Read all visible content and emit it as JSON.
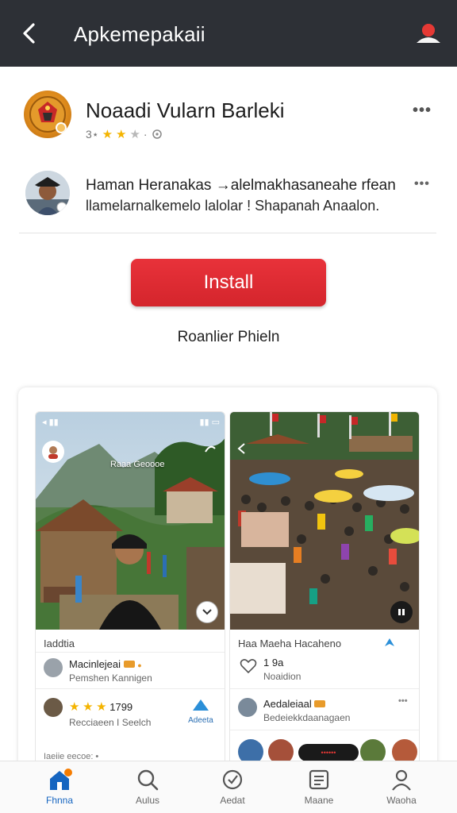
{
  "header": {
    "title": "Apkemepakaii",
    "back_icon": "chevron-left-icon",
    "account_icon": "account-icon"
  },
  "app": {
    "name": "Noaadi Vularn Barleki",
    "rating_text": "3⋆",
    "rating_stars": 2.5,
    "rating_suffix": "·",
    "more_label": "•••"
  },
  "developer": {
    "line1": "Haman Heranakas →alelmakhasaneahe rfean",
    "line2": "llamelarnalkemelo lalolar ! Shapanah Anaalon.",
    "more_label": "•••"
  },
  "actions": {
    "install_label": "Install",
    "secondary_label": "Roanlier Phieln"
  },
  "feed": {
    "left": {
      "statusbar_left": "◂ ▮▮",
      "statusbar_right": "▮▮ ▭",
      "overlay_text": "Raaa Geoooe",
      "caption": "Iaddtia",
      "item1_name": "Macinlejeai",
      "item1_sub": "Pemshen Kannigen",
      "rating_value": "1799",
      "item2_sub": "Recciaeen I Seelch",
      "share_label": "Adeeta",
      "footer_text": "Iaeiie eecoe: •"
    },
    "right": {
      "caption": "Haa Maeha Hacaheno",
      "like_count": "1 9a",
      "like_sub": "Noaidion",
      "item_name": "Aedaleiaal",
      "item_sub": "Bedeiekkdaanagaen",
      "live_badge": "••••••"
    }
  },
  "nav": [
    {
      "label": "Fhnna",
      "icon": "home-icon"
    },
    {
      "label": "Aulus",
      "icon": "search-icon"
    },
    {
      "label": "Aedat",
      "icon": "updates-icon"
    },
    {
      "label": "Maane",
      "icon": "document-icon"
    },
    {
      "label": "Waoha",
      "icon": "profile-icon"
    }
  ],
  "colors": {
    "topbar": "#2d3036",
    "install": "#dc2a31",
    "active_nav": "#1565c0",
    "star": "#f4b400"
  }
}
